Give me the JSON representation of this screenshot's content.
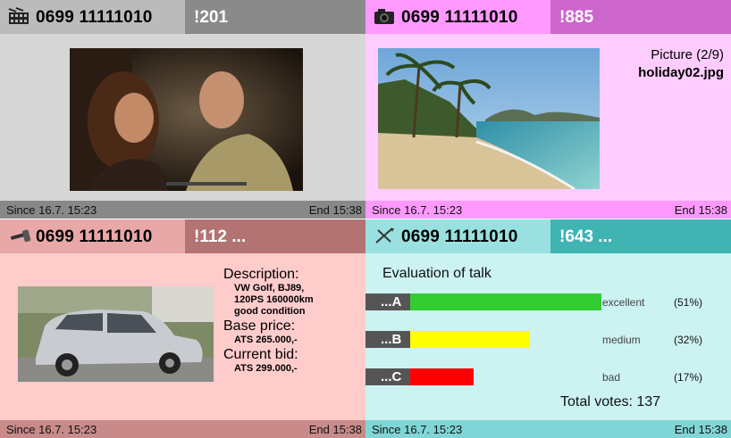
{
  "panels": [
    {
      "icon": "film-clapper-icon",
      "phone": "0699 11111010",
      "code": "!201",
      "since": "Since 16.7. 15:23",
      "end": "End 15:38"
    },
    {
      "icon": "camera-icon",
      "phone": "0699 11111010",
      "code": "!885",
      "picture_counter": "Picture (2/9)",
      "filename": "holiday02.jpg",
      "since": "Since 16.7. 15:23",
      "end": "End 15:38"
    },
    {
      "icon": "gavel-icon",
      "phone": "0699 11111010",
      "code": "!112 ...",
      "description_label": "Description:",
      "description_lines": [
        "VW Golf, BJ89,",
        "120PS 160000km",
        "good condition"
      ],
      "base_price_label": "Base price:",
      "base_price": "ATS 265.000,-",
      "current_bid_label": "Current bid:",
      "current_bid": "ATS 299.000,-",
      "since": "Since 16.7. 15:23",
      "end": "End 15:38"
    },
    {
      "icon": "cross-icon",
      "phone": "0699 11111010",
      "code": "!643 ...",
      "title": "Evaluation of talk",
      "options": [
        {
          "tag": "...A",
          "label": "excellent",
          "percent_text": "(51%)",
          "share": 0.51,
          "color": "#33cc33"
        },
        {
          "tag": "...B",
          "label": "medium",
          "percent_text": "(32%)",
          "share": 0.32,
          "color": "#ffff00"
        },
        {
          "tag": "...C",
          "label": "bad",
          "percent_text": "(17%)",
          "share": 0.17,
          "color": "#ff0000"
        }
      ],
      "total_votes": "Total votes: 137",
      "since": "Since 16.7. 15:23",
      "end": "End 15:38"
    }
  ]
}
